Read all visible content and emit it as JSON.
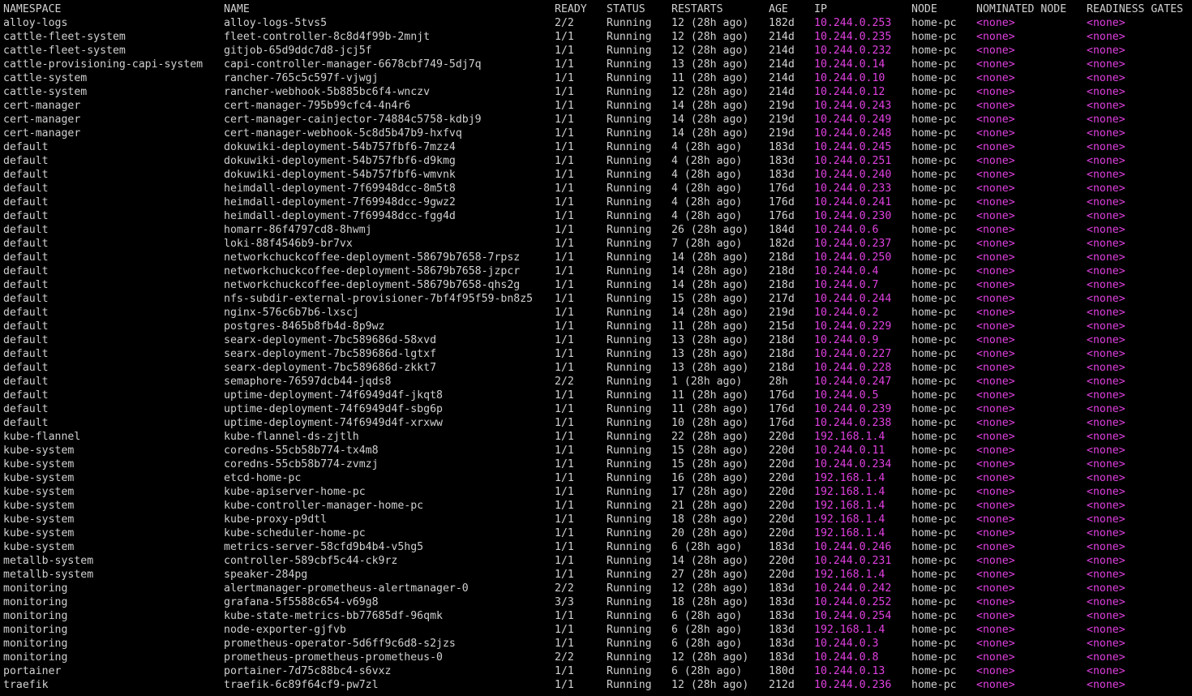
{
  "colors": {
    "background": "#000000",
    "text": "#d0d0d0",
    "highlight": "#e040e0"
  },
  "headers": {
    "namespace": "NAMESPACE",
    "name": "NAME",
    "ready": "READY",
    "status": "STATUS",
    "restarts": "RESTARTS",
    "age": "AGE",
    "ip": "IP",
    "node": "NODE",
    "nominated_node": "NOMINATED NODE",
    "readiness_gates": "READINESS GATES"
  },
  "rows": [
    {
      "ns": "alloy-logs",
      "name": "alloy-logs-5tvs5",
      "ready": "2/2",
      "status": "Running",
      "restarts": "12 (28h ago)",
      "age": "182d",
      "ip": "10.244.0.253",
      "node": "home-pc",
      "nom": "<none>",
      "rg": "<none>"
    },
    {
      "ns": "cattle-fleet-system",
      "name": "fleet-controller-8c8d4f99b-2mnjt",
      "ready": "1/1",
      "status": "Running",
      "restarts": "12 (28h ago)",
      "age": "214d",
      "ip": "10.244.0.235",
      "node": "home-pc",
      "nom": "<none>",
      "rg": "<none>"
    },
    {
      "ns": "cattle-fleet-system",
      "name": "gitjob-65d9ddc7d8-jcj5f",
      "ready": "1/1",
      "status": "Running",
      "restarts": "12 (28h ago)",
      "age": "214d",
      "ip": "10.244.0.232",
      "node": "home-pc",
      "nom": "<none>",
      "rg": "<none>"
    },
    {
      "ns": "cattle-provisioning-capi-system",
      "name": "capi-controller-manager-6678cbf749-5dj7q",
      "ready": "1/1",
      "status": "Running",
      "restarts": "13 (28h ago)",
      "age": "214d",
      "ip": "10.244.0.14",
      "node": "home-pc",
      "nom": "<none>",
      "rg": "<none>"
    },
    {
      "ns": "cattle-system",
      "name": "rancher-765c5c597f-vjwgj",
      "ready": "1/1",
      "status": "Running",
      "restarts": "11 (28h ago)",
      "age": "214d",
      "ip": "10.244.0.10",
      "node": "home-pc",
      "nom": "<none>",
      "rg": "<none>"
    },
    {
      "ns": "cattle-system",
      "name": "rancher-webhook-5b885bc6f4-wnczv",
      "ready": "1/1",
      "status": "Running",
      "restarts": "12 (28h ago)",
      "age": "214d",
      "ip": "10.244.0.12",
      "node": "home-pc",
      "nom": "<none>",
      "rg": "<none>"
    },
    {
      "ns": "cert-manager",
      "name": "cert-manager-795b99cfc4-4n4r6",
      "ready": "1/1",
      "status": "Running",
      "restarts": "14 (28h ago)",
      "age": "219d",
      "ip": "10.244.0.243",
      "node": "home-pc",
      "nom": "<none>",
      "rg": "<none>"
    },
    {
      "ns": "cert-manager",
      "name": "cert-manager-cainjector-74884c5758-kdbj9",
      "ready": "1/1",
      "status": "Running",
      "restarts": "14 (28h ago)",
      "age": "219d",
      "ip": "10.244.0.249",
      "node": "home-pc",
      "nom": "<none>",
      "rg": "<none>"
    },
    {
      "ns": "cert-manager",
      "name": "cert-manager-webhook-5c8d5b47b9-hxfvq",
      "ready": "1/1",
      "status": "Running",
      "restarts": "14 (28h ago)",
      "age": "219d",
      "ip": "10.244.0.248",
      "node": "home-pc",
      "nom": "<none>",
      "rg": "<none>"
    },
    {
      "ns": "default",
      "name": "dokuwiki-deployment-54b757fbf6-7mzz4",
      "ready": "1/1",
      "status": "Running",
      "restarts": "4 (28h ago)",
      "age": "183d",
      "ip": "10.244.0.245",
      "node": "home-pc",
      "nom": "<none>",
      "rg": "<none>"
    },
    {
      "ns": "default",
      "name": "dokuwiki-deployment-54b757fbf6-d9kmg",
      "ready": "1/1",
      "status": "Running",
      "restarts": "4 (28h ago)",
      "age": "183d",
      "ip": "10.244.0.251",
      "node": "home-pc",
      "nom": "<none>",
      "rg": "<none>"
    },
    {
      "ns": "default",
      "name": "dokuwiki-deployment-54b757fbf6-wmvnk",
      "ready": "1/1",
      "status": "Running",
      "restarts": "4 (28h ago)",
      "age": "183d",
      "ip": "10.244.0.240",
      "node": "home-pc",
      "nom": "<none>",
      "rg": "<none>"
    },
    {
      "ns": "default",
      "name": "heimdall-deployment-7f69948dcc-8m5t8",
      "ready": "1/1",
      "status": "Running",
      "restarts": "4 (28h ago)",
      "age": "176d",
      "ip": "10.244.0.233",
      "node": "home-pc",
      "nom": "<none>",
      "rg": "<none>"
    },
    {
      "ns": "default",
      "name": "heimdall-deployment-7f69948dcc-9gwz2",
      "ready": "1/1",
      "status": "Running",
      "restarts": "4 (28h ago)",
      "age": "176d",
      "ip": "10.244.0.241",
      "node": "home-pc",
      "nom": "<none>",
      "rg": "<none>"
    },
    {
      "ns": "default",
      "name": "heimdall-deployment-7f69948dcc-fgg4d",
      "ready": "1/1",
      "status": "Running",
      "restarts": "4 (28h ago)",
      "age": "176d",
      "ip": "10.244.0.230",
      "node": "home-pc",
      "nom": "<none>",
      "rg": "<none>"
    },
    {
      "ns": "default",
      "name": "homarr-86f4797cd8-8hwmj",
      "ready": "1/1",
      "status": "Running",
      "restarts": "26 (28h ago)",
      "age": "184d",
      "ip": "10.244.0.6",
      "node": "home-pc",
      "nom": "<none>",
      "rg": "<none>"
    },
    {
      "ns": "default",
      "name": "loki-88f4546b9-br7vx",
      "ready": "1/1",
      "status": "Running",
      "restarts": "7 (28h ago)",
      "age": "182d",
      "ip": "10.244.0.237",
      "node": "home-pc",
      "nom": "<none>",
      "rg": "<none>"
    },
    {
      "ns": "default",
      "name": "networkchuckcoffee-deployment-58679b7658-7rpsz",
      "ready": "1/1",
      "status": "Running",
      "restarts": "14 (28h ago)",
      "age": "218d",
      "ip": "10.244.0.250",
      "node": "home-pc",
      "nom": "<none>",
      "rg": "<none>"
    },
    {
      "ns": "default",
      "name": "networkchuckcoffee-deployment-58679b7658-jzpcr",
      "ready": "1/1",
      "status": "Running",
      "restarts": "14 (28h ago)",
      "age": "218d",
      "ip": "10.244.0.4",
      "node": "home-pc",
      "nom": "<none>",
      "rg": "<none>"
    },
    {
      "ns": "default",
      "name": "networkchuckcoffee-deployment-58679b7658-qhs2g",
      "ready": "1/1",
      "status": "Running",
      "restarts": "14 (28h ago)",
      "age": "218d",
      "ip": "10.244.0.7",
      "node": "home-pc",
      "nom": "<none>",
      "rg": "<none>"
    },
    {
      "ns": "default",
      "name": "nfs-subdir-external-provisioner-7bf4f95f59-bn8z5",
      "ready": "1/1",
      "status": "Running",
      "restarts": "15 (28h ago)",
      "age": "217d",
      "ip": "10.244.0.244",
      "node": "home-pc",
      "nom": "<none>",
      "rg": "<none>"
    },
    {
      "ns": "default",
      "name": "nginx-576c6b7b6-lxscj",
      "ready": "1/1",
      "status": "Running",
      "restarts": "14 (28h ago)",
      "age": "219d",
      "ip": "10.244.0.2",
      "node": "home-pc",
      "nom": "<none>",
      "rg": "<none>"
    },
    {
      "ns": "default",
      "name": "postgres-8465b8fb4d-8p9wz",
      "ready": "1/1",
      "status": "Running",
      "restarts": "11 (28h ago)",
      "age": "215d",
      "ip": "10.244.0.229",
      "node": "home-pc",
      "nom": "<none>",
      "rg": "<none>"
    },
    {
      "ns": "default",
      "name": "searx-deployment-7bc589686d-58xvd",
      "ready": "1/1",
      "status": "Running",
      "restarts": "13 (28h ago)",
      "age": "218d",
      "ip": "10.244.0.9",
      "node": "home-pc",
      "nom": "<none>",
      "rg": "<none>"
    },
    {
      "ns": "default",
      "name": "searx-deployment-7bc589686d-lgtxf",
      "ready": "1/1",
      "status": "Running",
      "restarts": "13 (28h ago)",
      "age": "218d",
      "ip": "10.244.0.227",
      "node": "home-pc",
      "nom": "<none>",
      "rg": "<none>"
    },
    {
      "ns": "default",
      "name": "searx-deployment-7bc589686d-zkkt7",
      "ready": "1/1",
      "status": "Running",
      "restarts": "13 (28h ago)",
      "age": "218d",
      "ip": "10.244.0.228",
      "node": "home-pc",
      "nom": "<none>",
      "rg": "<none>"
    },
    {
      "ns": "default",
      "name": "semaphore-76597dcb44-jqds8",
      "ready": "2/2",
      "status": "Running",
      "restarts": "1 (28h ago)",
      "age": "28h",
      "ip": "10.244.0.247",
      "node": "home-pc",
      "nom": "<none>",
      "rg": "<none>"
    },
    {
      "ns": "default",
      "name": "uptime-deployment-74f6949d4f-jkqt8",
      "ready": "1/1",
      "status": "Running",
      "restarts": "11 (28h ago)",
      "age": "176d",
      "ip": "10.244.0.5",
      "node": "home-pc",
      "nom": "<none>",
      "rg": "<none>"
    },
    {
      "ns": "default",
      "name": "uptime-deployment-74f6949d4f-sbg6p",
      "ready": "1/1",
      "status": "Running",
      "restarts": "11 (28h ago)",
      "age": "176d",
      "ip": "10.244.0.239",
      "node": "home-pc",
      "nom": "<none>",
      "rg": "<none>"
    },
    {
      "ns": "default",
      "name": "uptime-deployment-74f6949d4f-xrxww",
      "ready": "1/1",
      "status": "Running",
      "restarts": "10 (28h ago)",
      "age": "176d",
      "ip": "10.244.0.238",
      "node": "home-pc",
      "nom": "<none>",
      "rg": "<none>"
    },
    {
      "ns": "kube-flannel",
      "name": "kube-flannel-ds-zjtlh",
      "ready": "1/1",
      "status": "Running",
      "restarts": "22 (28h ago)",
      "age": "220d",
      "ip": "192.168.1.4",
      "node": "home-pc",
      "nom": "<none>",
      "rg": "<none>"
    },
    {
      "ns": "kube-system",
      "name": "coredns-55cb58b774-tx4m8",
      "ready": "1/1",
      "status": "Running",
      "restarts": "15 (28h ago)",
      "age": "220d",
      "ip": "10.244.0.11",
      "node": "home-pc",
      "nom": "<none>",
      "rg": "<none>"
    },
    {
      "ns": "kube-system",
      "name": "coredns-55cb58b774-zvmzj",
      "ready": "1/1",
      "status": "Running",
      "restarts": "15 (28h ago)",
      "age": "220d",
      "ip": "10.244.0.234",
      "node": "home-pc",
      "nom": "<none>",
      "rg": "<none>"
    },
    {
      "ns": "kube-system",
      "name": "etcd-home-pc",
      "ready": "1/1",
      "status": "Running",
      "restarts": "16 (28h ago)",
      "age": "220d",
      "ip": "192.168.1.4",
      "node": "home-pc",
      "nom": "<none>",
      "rg": "<none>"
    },
    {
      "ns": "kube-system",
      "name": "kube-apiserver-home-pc",
      "ready": "1/1",
      "status": "Running",
      "restarts": "17 (28h ago)",
      "age": "220d",
      "ip": "192.168.1.4",
      "node": "home-pc",
      "nom": "<none>",
      "rg": "<none>"
    },
    {
      "ns": "kube-system",
      "name": "kube-controller-manager-home-pc",
      "ready": "1/1",
      "status": "Running",
      "restarts": "21 (28h ago)",
      "age": "220d",
      "ip": "192.168.1.4",
      "node": "home-pc",
      "nom": "<none>",
      "rg": "<none>"
    },
    {
      "ns": "kube-system",
      "name": "kube-proxy-p9dtl",
      "ready": "1/1",
      "status": "Running",
      "restarts": "18 (28h ago)",
      "age": "220d",
      "ip": "192.168.1.4",
      "node": "home-pc",
      "nom": "<none>",
      "rg": "<none>"
    },
    {
      "ns": "kube-system",
      "name": "kube-scheduler-home-pc",
      "ready": "1/1",
      "status": "Running",
      "restarts": "20 (28h ago)",
      "age": "220d",
      "ip": "192.168.1.4",
      "node": "home-pc",
      "nom": "<none>",
      "rg": "<none>"
    },
    {
      "ns": "kube-system",
      "name": "metrics-server-58cfd9b4b4-v5hg5",
      "ready": "1/1",
      "status": "Running",
      "restarts": "6 (28h ago)",
      "age": "183d",
      "ip": "10.244.0.246",
      "node": "home-pc",
      "nom": "<none>",
      "rg": "<none>"
    },
    {
      "ns": "metallb-system",
      "name": "controller-589cbf5c44-ck9rz",
      "ready": "1/1",
      "status": "Running",
      "restarts": "14 (28h ago)",
      "age": "220d",
      "ip": "10.244.0.231",
      "node": "home-pc",
      "nom": "<none>",
      "rg": "<none>"
    },
    {
      "ns": "metallb-system",
      "name": "speaker-284pg",
      "ready": "1/1",
      "status": "Running",
      "restarts": "27 (28h ago)",
      "age": "220d",
      "ip": "192.168.1.4",
      "node": "home-pc",
      "nom": "<none>",
      "rg": "<none>"
    },
    {
      "ns": "monitoring",
      "name": "alertmanager-prometheus-alertmanager-0",
      "ready": "2/2",
      "status": "Running",
      "restarts": "12 (28h ago)",
      "age": "183d",
      "ip": "10.244.0.242",
      "node": "home-pc",
      "nom": "<none>",
      "rg": "<none>"
    },
    {
      "ns": "monitoring",
      "name": "grafana-5f5588c654-v69g8",
      "ready": "3/3",
      "status": "Running",
      "restarts": "18 (28h ago)",
      "age": "183d",
      "ip": "10.244.0.252",
      "node": "home-pc",
      "nom": "<none>",
      "rg": "<none>"
    },
    {
      "ns": "monitoring",
      "name": "kube-state-metrics-bb77685df-96qmk",
      "ready": "1/1",
      "status": "Running",
      "restarts": "6 (28h ago)",
      "age": "183d",
      "ip": "10.244.0.254",
      "node": "home-pc",
      "nom": "<none>",
      "rg": "<none>"
    },
    {
      "ns": "monitoring",
      "name": "node-exporter-gjfvb",
      "ready": "1/1",
      "status": "Running",
      "restarts": "6 (28h ago)",
      "age": "183d",
      "ip": "192.168.1.4",
      "node": "home-pc",
      "nom": "<none>",
      "rg": "<none>"
    },
    {
      "ns": "monitoring",
      "name": "prometheus-operator-5d6ff9c6d8-s2jzs",
      "ready": "1/1",
      "status": "Running",
      "restarts": "6 (28h ago)",
      "age": "183d",
      "ip": "10.244.0.3",
      "node": "home-pc",
      "nom": "<none>",
      "rg": "<none>"
    },
    {
      "ns": "monitoring",
      "name": "prometheus-prometheus-prometheus-0",
      "ready": "2/2",
      "status": "Running",
      "restarts": "12 (28h ago)",
      "age": "183d",
      "ip": "10.244.0.8",
      "node": "home-pc",
      "nom": "<none>",
      "rg": "<none>"
    },
    {
      "ns": "portainer",
      "name": "portainer-7d75c88bc4-s6vxz",
      "ready": "1/1",
      "status": "Running",
      "restarts": "6 (28h ago)",
      "age": "180d",
      "ip": "10.244.0.13",
      "node": "home-pc",
      "nom": "<none>",
      "rg": "<none>"
    },
    {
      "ns": "traefik",
      "name": "traefik-6c89f64cf9-pw7zl",
      "ready": "1/1",
      "status": "Running",
      "restarts": "12 (28h ago)",
      "age": "212d",
      "ip": "10.244.0.236",
      "node": "home-pc",
      "nom": "<none>",
      "rg": "<none>"
    }
  ]
}
